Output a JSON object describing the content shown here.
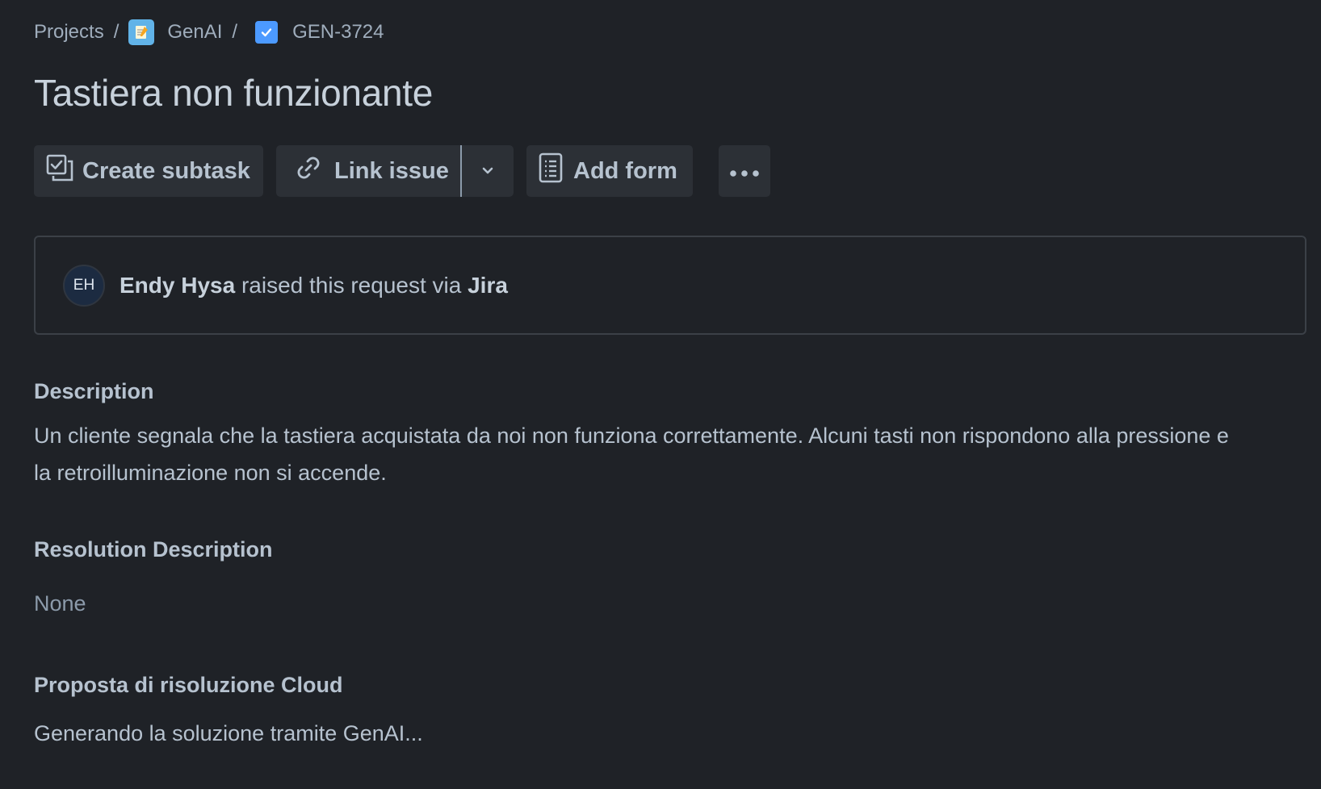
{
  "breadcrumb": {
    "projects": "Projects",
    "separator": "/",
    "project_name": "GenAI",
    "project_icon": "notepad-icon",
    "issue_key": "GEN-3724",
    "issue_type_icon": "task-checkbox-icon"
  },
  "issue": {
    "title": "Tastiera non funzionante"
  },
  "toolbar": {
    "create_subtask": "Create subtask",
    "link_issue": "Link issue",
    "add_form": "Add form",
    "more_icon": "ellipsis-icon",
    "dropdown_icon": "chevron-down-icon"
  },
  "request": {
    "avatar_initials": "EH",
    "reporter": "Endy Hysa",
    "middle_text": "raised this request via",
    "channel": "Jira"
  },
  "description": {
    "label": "Description",
    "text": "Un cliente segnala che la tastiera acquistata da noi non funziona correttamente. Alcuni tasti non rispondono alla pressione e la retroilluminazione non si accende."
  },
  "resolution": {
    "label": "Resolution Description",
    "value": "None"
  },
  "proposal": {
    "label": "Proposta di risoluzione Cloud",
    "value": "Generando la soluzione tramite GenAI..."
  },
  "colors": {
    "background": "#1f2227",
    "button_bg": "#2c3036",
    "text": "#b6c2cf",
    "muted": "#8c9bab",
    "task_icon": "#4c9aff",
    "project_icon": "#61b3e8"
  }
}
